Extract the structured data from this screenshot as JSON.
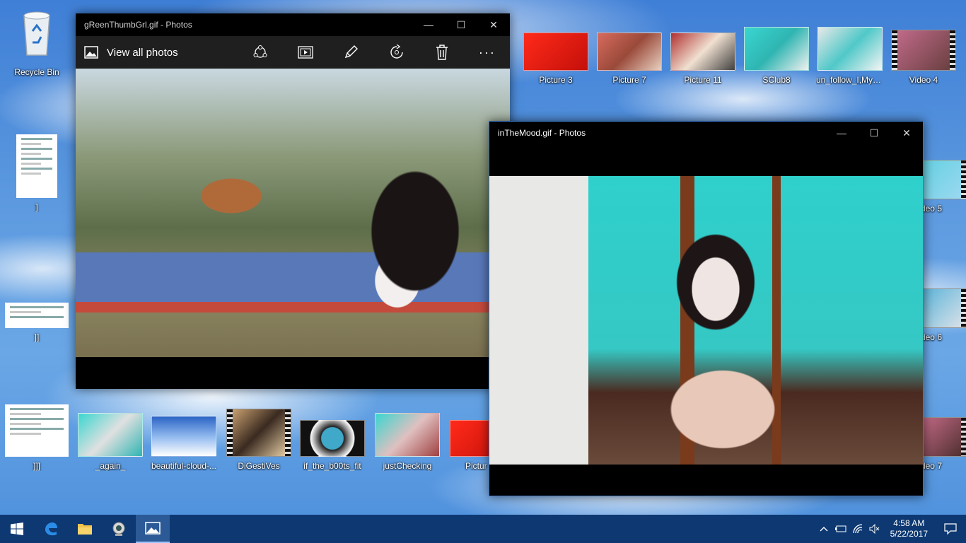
{
  "desktop": {
    "recycle_bin": "Recycle Bin",
    "top_row": [
      "Picture 3",
      "Picture 7",
      "Picture 11",
      "SClub8",
      "un_follow_I,MySelf_",
      "Video 4"
    ],
    "left_column": [
      "]",
      "]]",
      "]]]"
    ],
    "bottom_row": [
      "_again_",
      "beautiful-cloud-...",
      "DiGestiVes",
      "if_the_b00ts_fit",
      "justChecking",
      "Pictur"
    ],
    "right_column": [
      "ideo 5",
      "ideo 6",
      "ideo 7"
    ]
  },
  "window1": {
    "title": "gReenThumbGrl.gif - Photos",
    "view_all": "View all photos"
  },
  "window2": {
    "title": "inTheMood.gif - Photos"
  },
  "taskbar": {
    "time": "4:58 AM",
    "date": "5/22/2017"
  },
  "colors": {
    "taskbar": "#0d3872",
    "accent": "#2c5a96"
  }
}
